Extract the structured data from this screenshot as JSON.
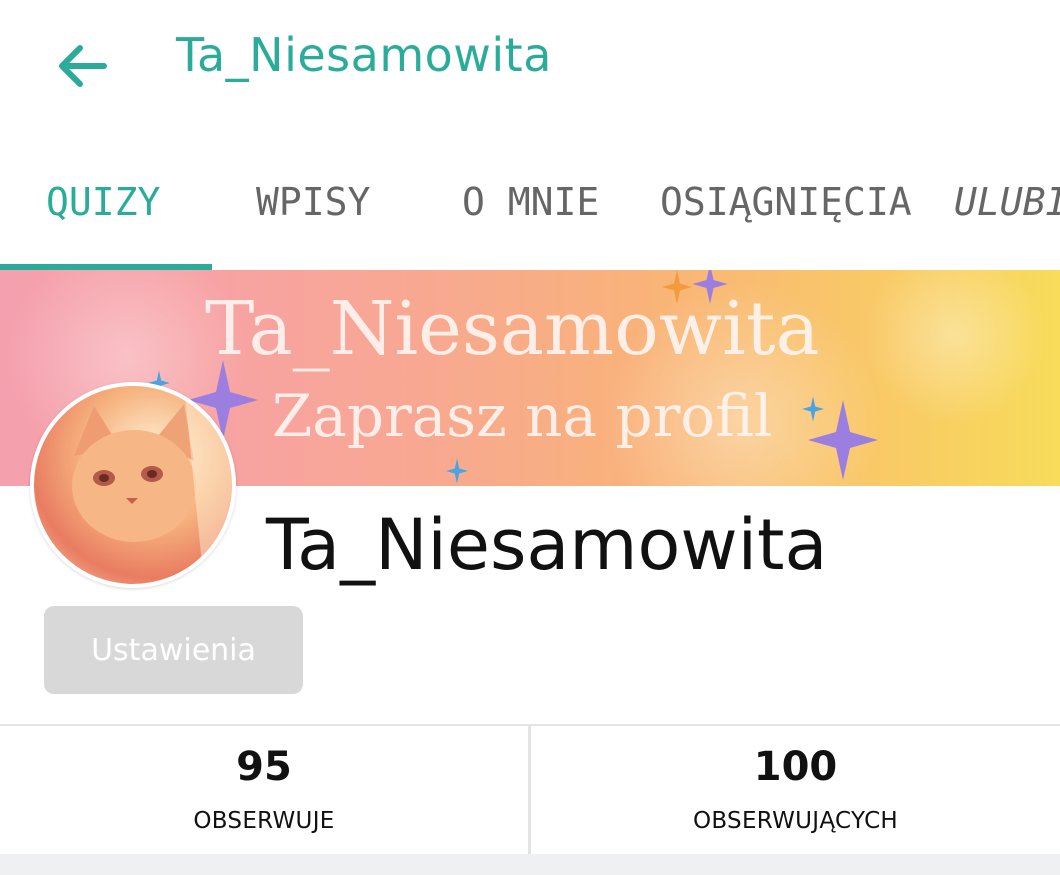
{
  "header": {
    "title": "Ta_Niesamowita",
    "back_icon": "arrow-left-icon",
    "accent_color": "#2bac9a"
  },
  "tabs": [
    {
      "label": "QUIZY",
      "active": true
    },
    {
      "label": "WPISY",
      "active": false
    },
    {
      "label": "O MNIE",
      "active": false
    },
    {
      "label": "OSIĄGNIĘCIA",
      "active": false
    },
    {
      "label": "ULUBI",
      "active": false
    }
  ],
  "banner": {
    "line1": "Ta_Niesamowita",
    "line2": "Zaprasz na profil"
  },
  "profile": {
    "name": "Ta_Niesamowita",
    "settings_label": "Ustawienia"
  },
  "stats": {
    "following": {
      "count": "95",
      "label": "OBSERWUJE"
    },
    "followers": {
      "count": "100",
      "label": "OBSERWUJĄCYCH"
    }
  }
}
